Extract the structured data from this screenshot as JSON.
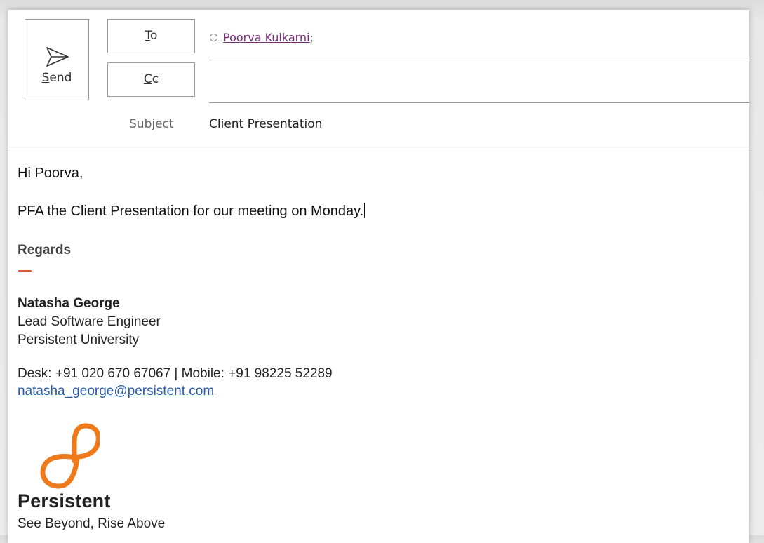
{
  "compose": {
    "send_label": "Send",
    "to_label": "To",
    "cc_label": "Cc",
    "to_recipient": "Poorva Kulkarni",
    "to_separator": ";",
    "cc_value": "",
    "subject_label": "Subject",
    "subject_value": "Client Presentation"
  },
  "body": {
    "greeting": "Hi Poorva,",
    "message": "PFA the Client Presentation for our meeting on Monday."
  },
  "signature": {
    "closing": "Regards",
    "name": "Natasha George",
    "title": "Lead Software Engineer",
    "organization": "Persistent University",
    "phone": "Desk: +91 020 670 67067 | Mobile: +91 98225 52289",
    "email": "natasha_george@persistent.com",
    "logo_text": "Persistent",
    "tagline": "See Beyond, Rise Above"
  },
  "colors": {
    "accent_orange": "#f07a1a",
    "link_blue": "#2a5aa8",
    "recipient_purple": "#7a2a7a"
  },
  "icons": {
    "send": "send-icon",
    "presence": "presence-circle-icon",
    "logo": "persistent-logo-icon"
  }
}
